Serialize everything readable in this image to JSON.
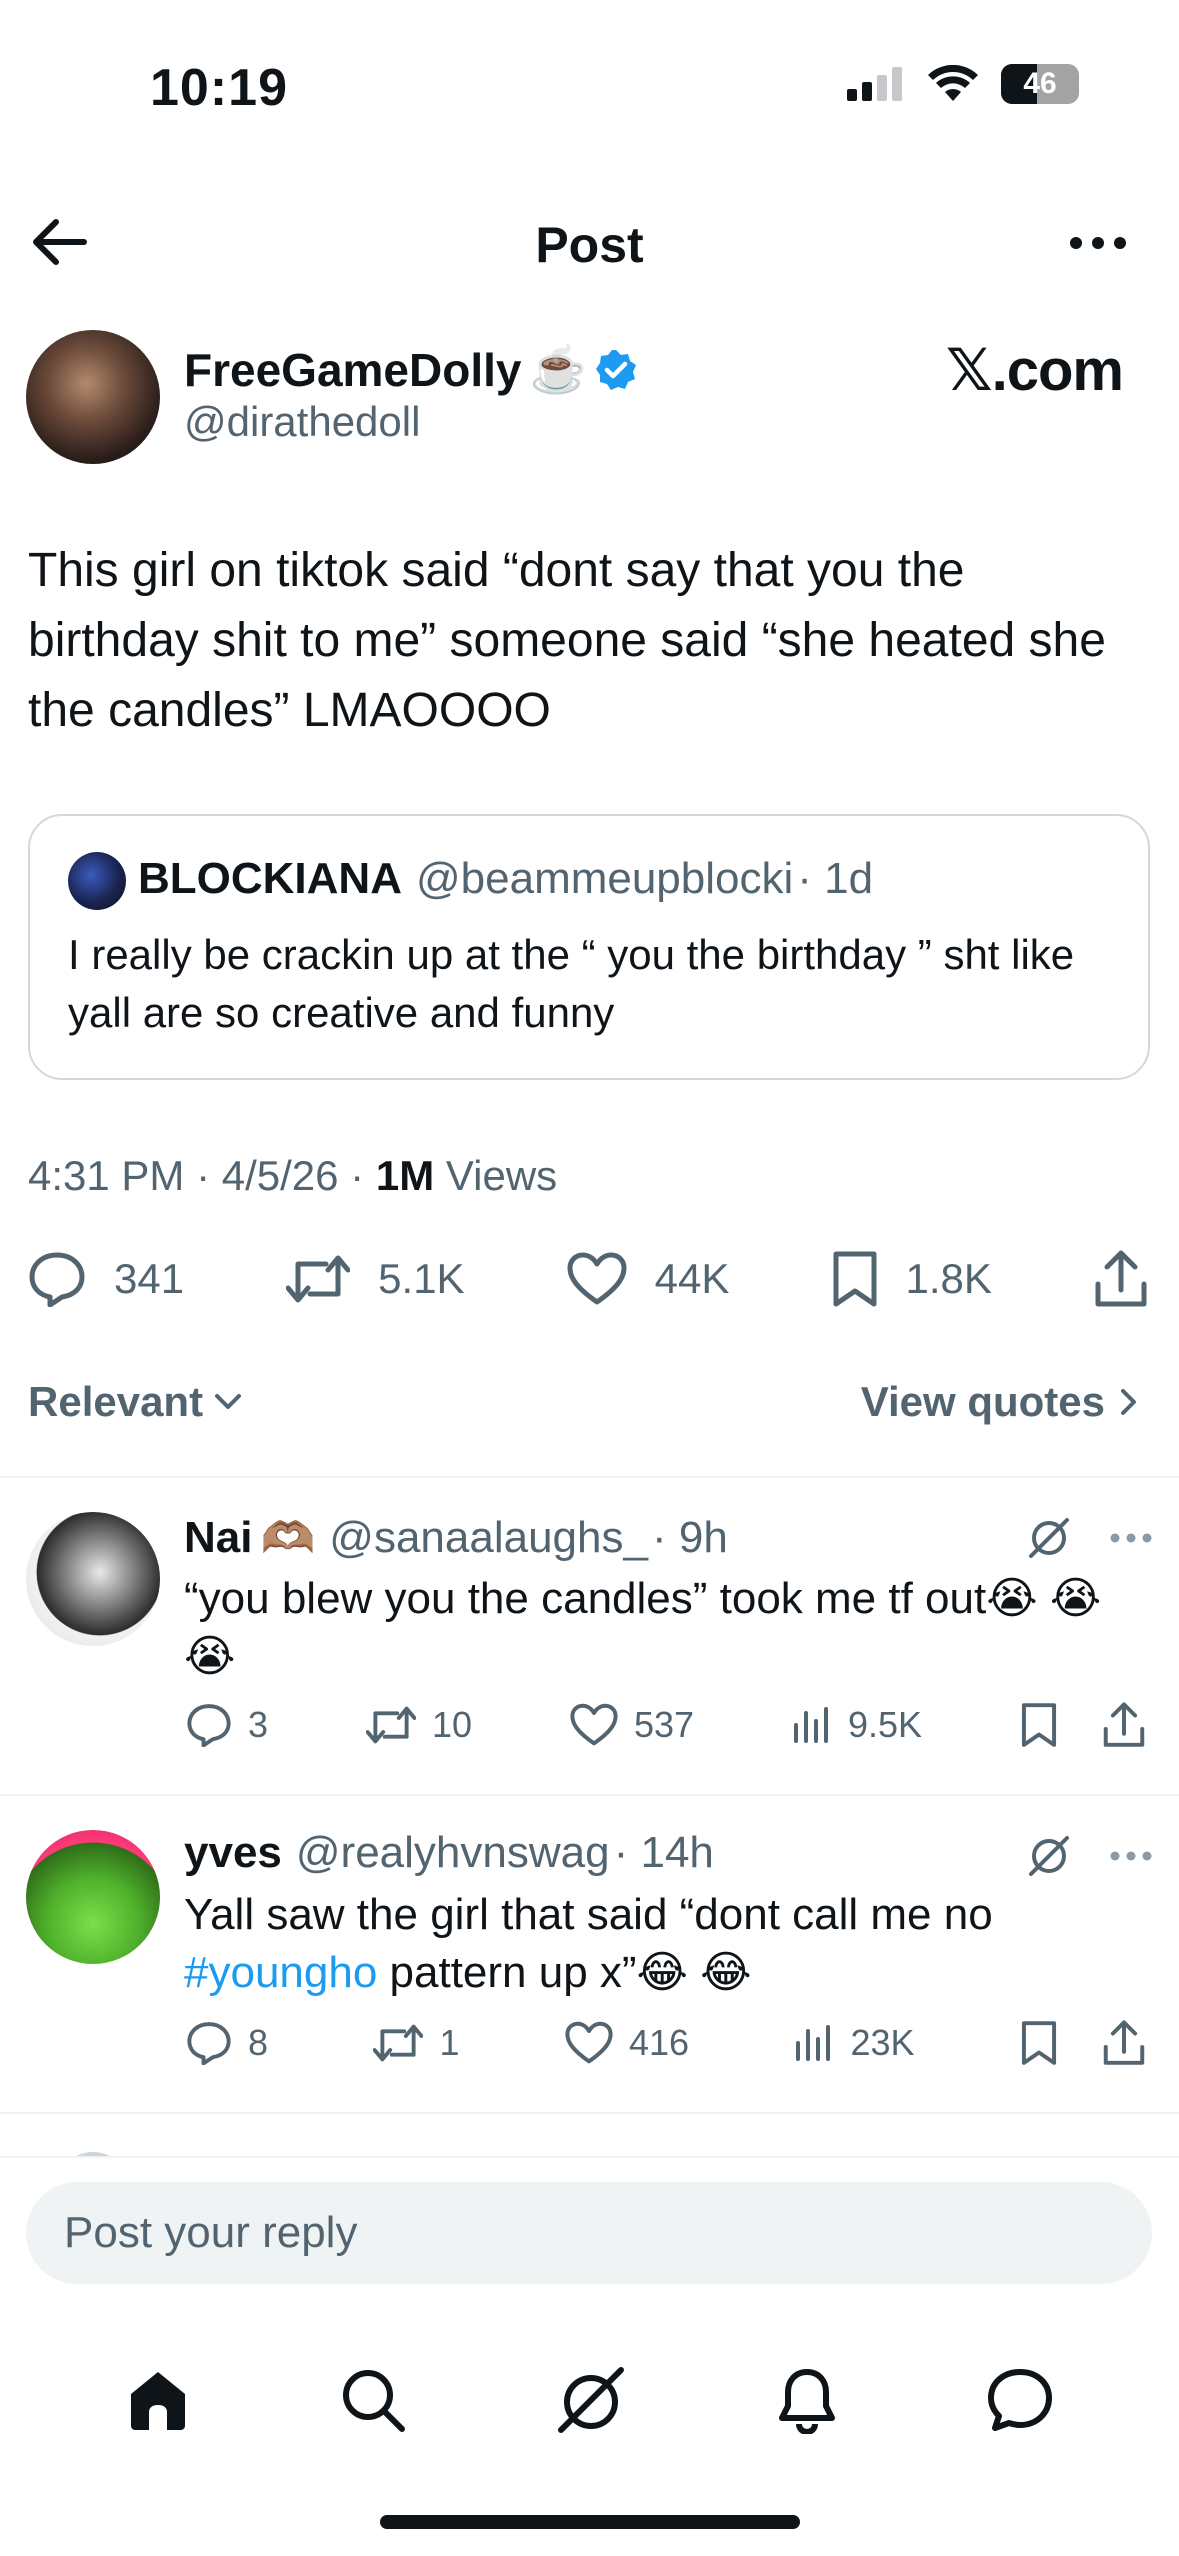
{
  "status_bar": {
    "time": "10:19",
    "battery": "46"
  },
  "nav": {
    "title": "Post",
    "back_icon": "arrow-left-icon",
    "more_icon": "more-horizontal-icon"
  },
  "post": {
    "author_name": "FreeGameDolly",
    "author_emoji": "☕️",
    "author_handle": "@dirathedoll",
    "watermark": "𝕏.com",
    "text": "This girl on tiktok said “dont say that you the birthday shit to me” someone said “she heated she the candles” LMAOOOO",
    "quote": {
      "name": "BLOCKIANA",
      "handle": "@beammeupblocki",
      "time": "· 1d",
      "text": "I really be crackin up at the “ you the birthday ” sht like yall are so creative and funny"
    },
    "meta": {
      "timestamp": "4:31 PM · 4/5/26 · ",
      "views_count": "1M",
      "views_label": " Views"
    },
    "stats": {
      "replies": "341",
      "reposts": "5.1K",
      "likes": "44K",
      "bookmarks": "1.8K"
    }
  },
  "sort": {
    "relevant_label": "Relevant",
    "view_quotes_label": "View quotes"
  },
  "replies": [
    {
      "name": "Nai",
      "emoji": "🫶🏽",
      "handle": "@sanaalaughs_",
      "time": "· 9h",
      "text": "“you blew you the candles” took me tf out😭 😭 😭",
      "replies": "3",
      "reposts": "10",
      "likes": "537",
      "views": "9.5K"
    },
    {
      "name": "yves",
      "handle": "@realyhvnswag",
      "time": "· 14h",
      "text_before": "Yall saw the girl that said “dont call me no ",
      "hashtag": "#youngho",
      "text_after": " pattern up x”😂 😂",
      "replies": "8",
      "reposts": "1",
      "likes": "416",
      "views": "23K"
    }
  ],
  "reply_box": {
    "placeholder": "Post your reply"
  },
  "colors": {
    "verified": "#1d9bf0",
    "text": "#0f1419",
    "secondary": "#536471",
    "link": "#1d9bf0"
  }
}
